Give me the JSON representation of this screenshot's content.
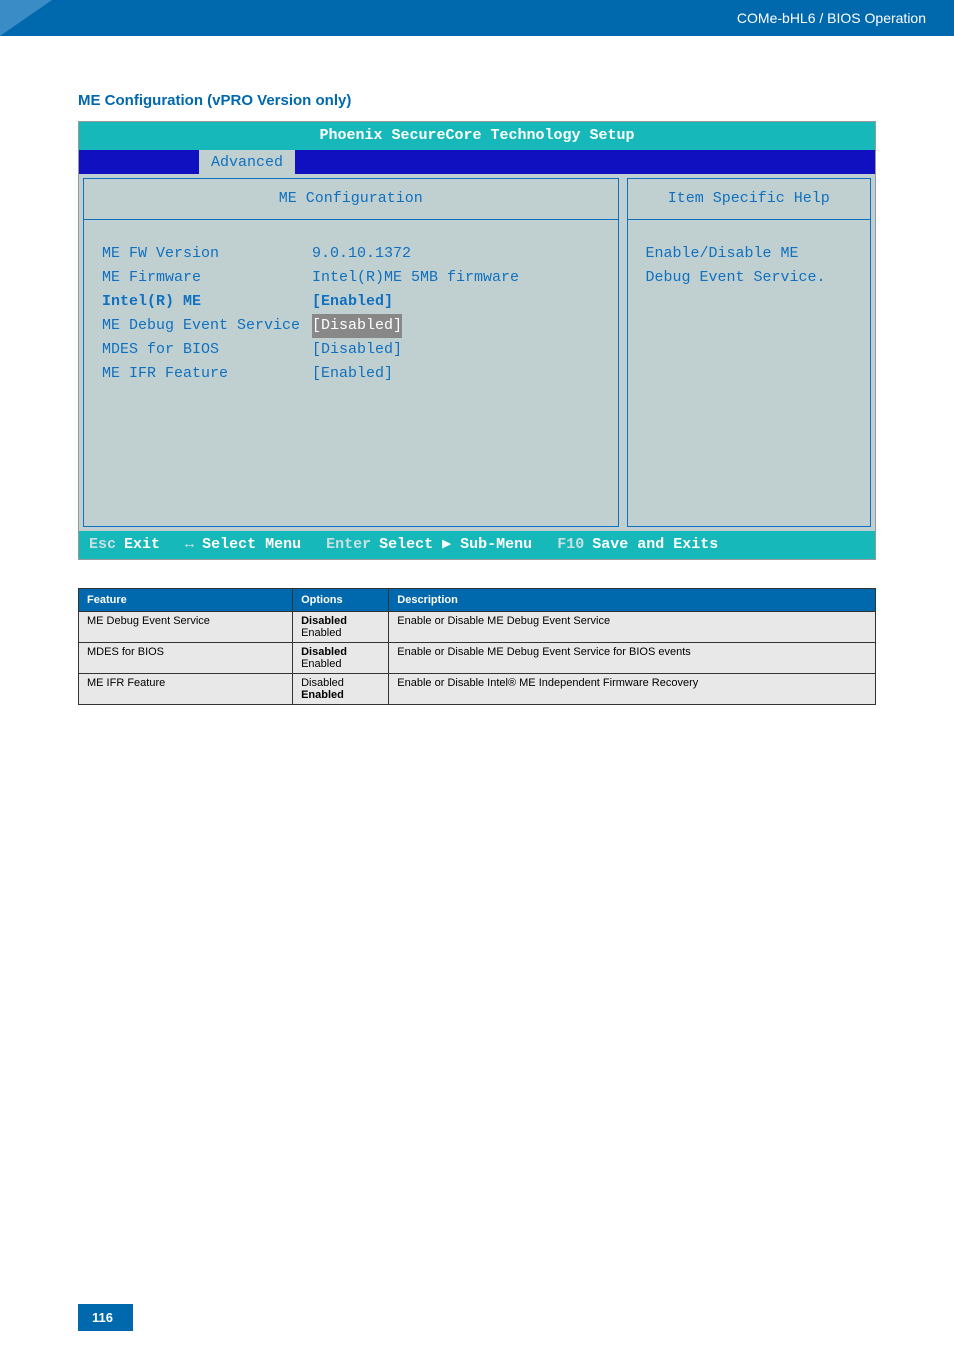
{
  "header": {
    "breadcrumb": "COMe-bHL6 / BIOS Operation"
  },
  "section": {
    "title": "ME Configuration (vPRO Version only)"
  },
  "bios": {
    "title": "Phoenix SecureCore Technology Setup",
    "active_tab": "Advanced",
    "pane_title": "ME Configuration",
    "help_title": "Item Specific Help",
    "help_text1": "Enable/Disable ME",
    "help_text2": "Debug Event Service.",
    "rows": {
      "r0": {
        "k": "ME FW Version",
        "v": "9.0.10.1372"
      },
      "r1": {
        "k": "ME Firmware",
        "v": "Intel(R)ME 5MB firmware"
      },
      "r2": {
        "k": "Intel(R) ME",
        "v": "[Enabled]"
      },
      "r3": {
        "k": "ME Debug Event Service",
        "v": "[Disabled]"
      },
      "r4": {
        "k": "MDES for BIOS",
        "v": "[Disabled]"
      },
      "r5": {
        "k": "ME IFR Feature",
        "v": "[Enabled]"
      }
    },
    "footer": {
      "k1": "Esc",
      "a1": "Exit",
      "k2": "↔",
      "a2": "Select Menu",
      "k3": "Enter",
      "a3": "Select ▶ Sub-Menu",
      "k4": "F10",
      "a4": "Save and Exits"
    }
  },
  "table": {
    "h1": "Feature",
    "h2": "Options",
    "h3": "Description",
    "r0": {
      "feature": "ME Debug Event Service",
      "opt1": "Disabled",
      "opt2": "Enabled",
      "desc": "Enable or Disable ME Debug Event Service"
    },
    "r1": {
      "feature": "MDES for BIOS",
      "opt1": "Disabled",
      "opt2": "Enabled",
      "desc": "Enable or Disable ME Debug Event Service for BIOS events"
    },
    "r2": {
      "feature": "ME IFR Feature",
      "opt1": "Disabled",
      "opt2": "Enabled",
      "desc": "Enable or Disable Intel® ME Independent Firmware Recovery"
    }
  },
  "page_number": "116"
}
